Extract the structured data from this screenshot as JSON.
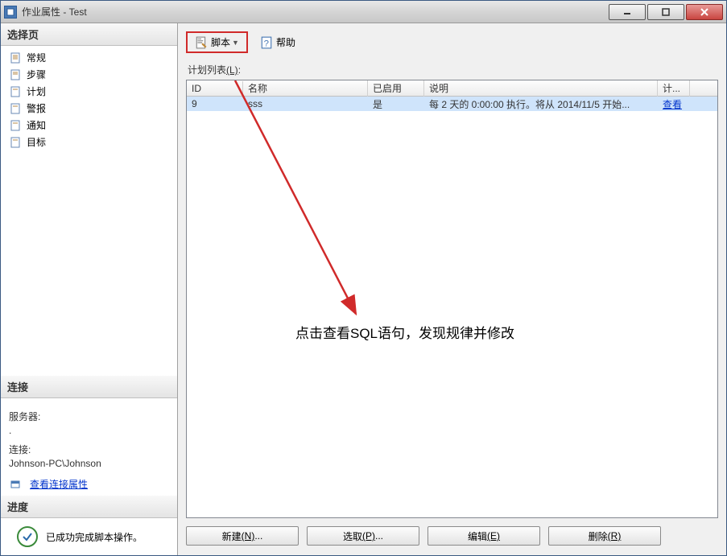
{
  "window": {
    "title": "作业属性 - Test"
  },
  "sidebar": {
    "selectPageHeader": "选择页",
    "items": [
      {
        "label": "常规"
      },
      {
        "label": "步骤"
      },
      {
        "label": "计划"
      },
      {
        "label": "警报"
      },
      {
        "label": "通知"
      },
      {
        "label": "目标"
      }
    ],
    "connectionHeader": "连接",
    "serverLabel": "服务器:",
    "serverValue": ".",
    "connLabel": "连接:",
    "connValue": "Johnson-PC\\Johnson",
    "connLinkText": "查看连接属性",
    "progressHeader": "进度",
    "progressText": "已成功完成脚本操作。"
  },
  "toolbar": {
    "scriptLabel": "脚本",
    "helpLabel": "帮助"
  },
  "main": {
    "listLabelPrefix": "计划列表",
    "listLabelAccel": "(L)",
    "listLabelSuffix": ":",
    "columns": {
      "id": "ID",
      "name": "名称",
      "enabled": "已启用",
      "desc": "说明",
      "plan": "计..."
    },
    "row": {
      "id": "9",
      "name": "sss",
      "enabled": "是",
      "desc": "每 2 天的 0:00:00 执行。将从 2014/11/5 开始...",
      "viewLink": "查看"
    },
    "annotationText": "点击查看SQL语句，发现规律并修改",
    "buttons": {
      "new": {
        "label": "新建",
        "accel": "(N)",
        "suffix": "..."
      },
      "pick": {
        "label": "选取",
        "accel": "(P)",
        "suffix": "..."
      },
      "edit": {
        "label": "编辑",
        "accel": "(E)"
      },
      "delete": {
        "label": "删除",
        "accel": "(R)"
      }
    }
  }
}
